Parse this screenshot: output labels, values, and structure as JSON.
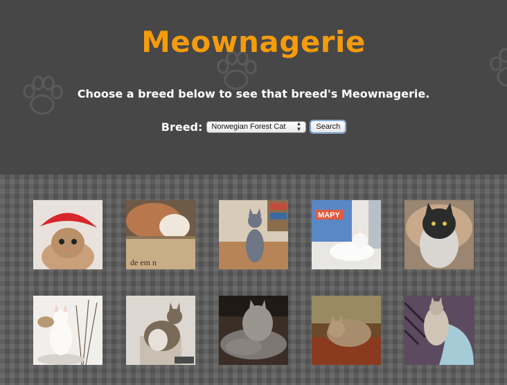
{
  "header": {
    "title": "Meownagerie",
    "subtitle": "Choose a breed below to see that breed's Meownagerie.",
    "breed_label": "Breed:",
    "selected_breed": "Norwegian Forest Cat",
    "search_label": "Search"
  },
  "gallery": {
    "photos": [
      {
        "name": "cat-photo-red-hat"
      },
      {
        "name": "cat-photo-box"
      },
      {
        "name": "cat-photo-gray-floor"
      },
      {
        "name": "cat-photo-white-window"
      },
      {
        "name": "cat-photo-black-bed"
      },
      {
        "name": "cat-photo-white-branches"
      },
      {
        "name": "cat-photo-tabby-standing"
      },
      {
        "name": "cat-photo-gray-rug"
      },
      {
        "name": "cat-photo-orange-floor"
      },
      {
        "name": "cat-photo-blanket"
      }
    ]
  }
}
